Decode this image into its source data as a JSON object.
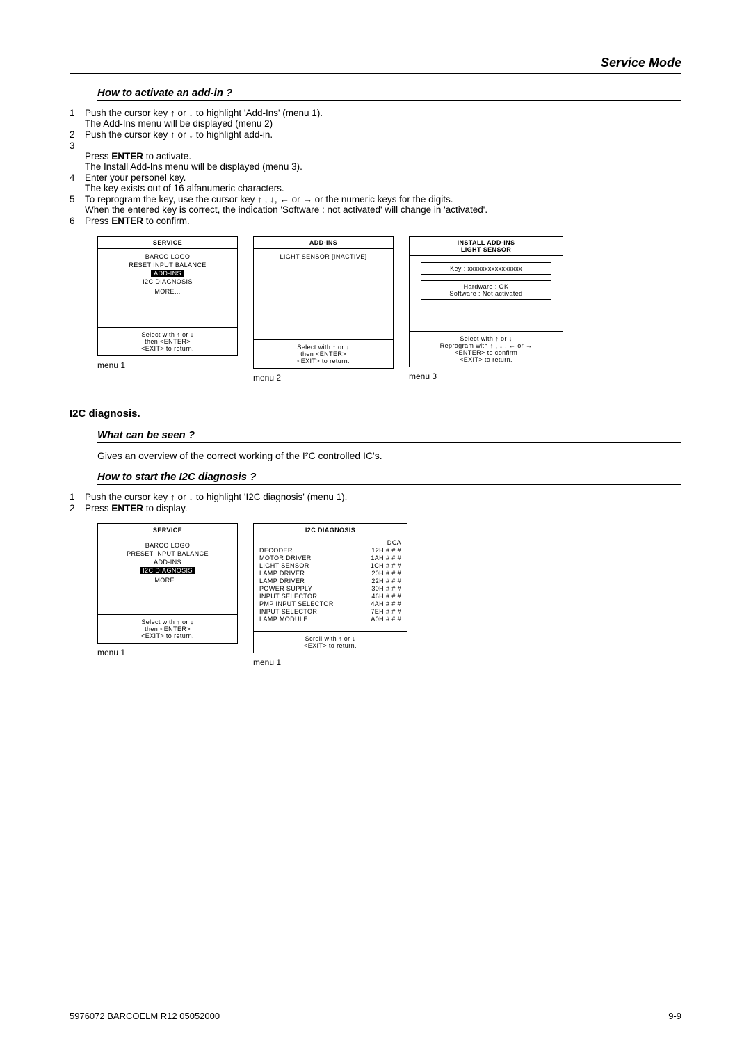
{
  "header": {
    "running": "Service Mode"
  },
  "sec1": {
    "title": "How to activate an add-in ?",
    "steps": [
      {
        "n": "1",
        "text": "Push the cursor key ↑ or ↓ to highlight 'Add-Ins' (menu 1).\nThe Add-Ins menu will be displayed (menu 2)"
      },
      {
        "n": "2",
        "text": "Push the cursor key ↑ or ↓ to highlight add-in."
      },
      {
        "n": "3",
        "text_a": "Press ",
        "bold": "ENTER",
        "text_b": " to activate.\nThe Install Add-Ins menu will be displayed (menu 3)."
      },
      {
        "n": "4",
        "text": "Enter your personel key.\nThe key exists out of 16 alfanumeric characters."
      },
      {
        "n": "5",
        "text": "To reprogram the key, use the cursor key ↑ , ↓, ←    or → or the numeric keys for the digits.\nWhen the entered key is correct, the indication 'Software : not activated' will change in 'activated'."
      },
      {
        "n": "6",
        "text_a": "Press ",
        "bold": "ENTER",
        "text_b": " to confirm."
      }
    ]
  },
  "menus1": {
    "m1": {
      "title": "SERVICE",
      "items": [
        "BARCO LOGO",
        "RESET INPUT BALANCE",
        "ADD-INS",
        "I2C DIAGNOSIS",
        "",
        "MORE..."
      ],
      "highlight_index": 2,
      "foot": "Select with ↑ or ↓\nthen <ENTER>\n<EXIT> to return.",
      "label": "menu 1"
    },
    "m2": {
      "title": "ADD-INS",
      "items": [
        "LIGHT SENSOR [INACTIVE]"
      ],
      "foot": "Select with ↑ or ↓\nthen <ENTER>\n<EXIT> to return.",
      "label": "menu 2"
    },
    "m3": {
      "title1": "INSTALL  ADD-INS",
      "title2": "LIGHT SENSOR",
      "key_line": "Key  :  xxxxxxxxxxxxxxxx",
      "hw": "Hardware : OK",
      "sw": "Software : Not activated",
      "foot": "Select with ↑ or ↓\nReprogram with ↑ , ↓ , ← or →\n<ENTER>  to  confirm\n<EXIT> to return.",
      "label": "menu 3"
    }
  },
  "i2c": {
    "heading": "I2C diagnosis.",
    "q1": "What can be seen ?",
    "q1_body": "Gives an overview of the correct working of the I²C controlled IC's.",
    "q2": "How to start the I2C diagnosis ?",
    "steps": [
      {
        "n": "1",
        "text": "Push the cursor key ↑ or ↓ to highlight 'I2C diagnosis' (menu 1)."
      },
      {
        "n": "2",
        "text_a": "Press ",
        "bold": "ENTER",
        "text_b": " to display."
      }
    ]
  },
  "menus2": {
    "m1": {
      "title": "SERVICE",
      "items": [
        "",
        "BARCO LOGO",
        "PRESET INPUT BALANCE",
        "ADD-INS",
        "I2C DIAGNOSIS",
        "",
        "MORE..."
      ],
      "highlight_index": 4,
      "foot": "Select with ↑ or ↓\nthen <ENTER>\n<EXIT> to return.",
      "label": "menu 1"
    },
    "m2": {
      "title": "I2C  DIAGNOSIS",
      "col_head_right": "DCA",
      "rows": [
        {
          "l": "DECODER",
          "r": "12H # # #"
        },
        {
          "l": "MOTOR DRIVER",
          "r": "1AH # # #"
        },
        {
          "l": "LIGHT SENSOR",
          "r": "1CH # # #"
        },
        {
          "l": "LAMP DRIVER",
          "r": "20H # # #"
        },
        {
          "l": "LAMP DRIVER",
          "r": "22H # # #"
        },
        {
          "l": "POWER SUPPLY",
          "r": "30H # # #"
        },
        {
          "l": "INPUT SELECTOR",
          "r": "46H # # #"
        },
        {
          "l": "PMP INPUT SELECTOR",
          "r": "4AH # # #"
        },
        {
          "l": "INPUT SELECTOR",
          "r": "7EH # # #"
        },
        {
          "l": "LAMP MODULE",
          "r": "A0H # # #"
        }
      ],
      "foot": "Scroll with ↑ or ↓\n<EXIT> to return.",
      "label": "menu 1"
    }
  },
  "footer": {
    "left": "5976072 BARCOELM R12 05052000",
    "right": "9-9"
  }
}
